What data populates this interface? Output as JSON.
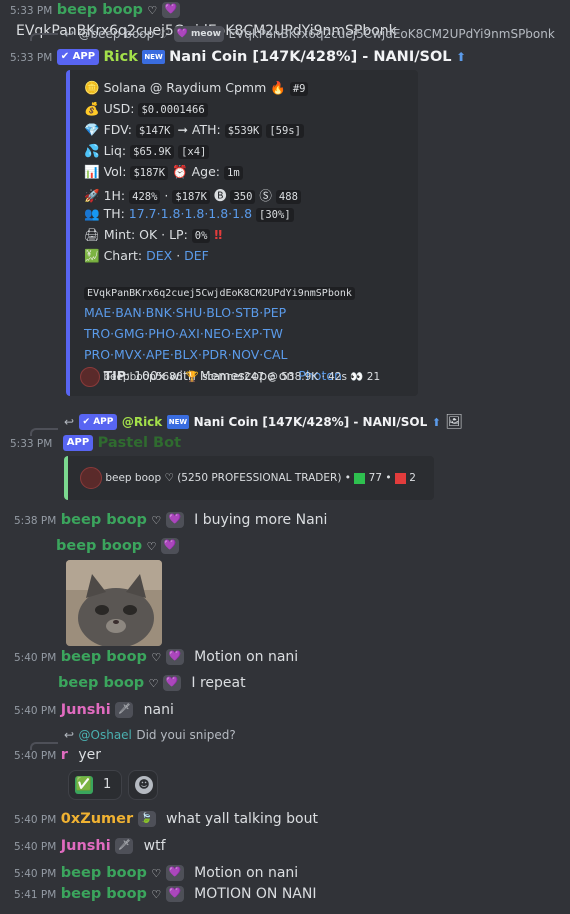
{
  "messages": {
    "m1": {
      "time": "5:33 PM",
      "author": "beep boop",
      "heart": "♡",
      "text": "EVqkPanBKrx6q2cuej5CwjdEoK8CM2UPdYi9nmSPbonk"
    },
    "m2": {
      "reply_author": "@beep boop",
      "reply_heart": "♡",
      "reply_tag": "meow",
      "reply_text": "EVqkPanBKrx6q2cuej5CwjdEoK8CM2UPdYi9nmSPbonk",
      "time": "5:33 PM",
      "app_badge": "APP",
      "author": "Rick",
      "new_badge": "NEW",
      "title": "Nani Coin [147K/428%] - NANI/SOL",
      "arrow": "⬆"
    },
    "embed": {
      "platform": "Solana @ Raydium Cpmm",
      "rank": "#9",
      "usd_label": "USD:",
      "usd": "$0.0001466",
      "fdv_label": "FDV:",
      "fdv": "$147K",
      "ath_arrow": "➞ ATH:",
      "ath": "$539K",
      "ath_age": "[59s]",
      "liq_label": "Liq:",
      "liq": "$65.9K",
      "liq_mult": "[x4]",
      "vol_label": "Vol:",
      "vol": "$187K",
      "age_label": "Age:",
      "age": "1m",
      "h1_label": "1H:",
      "h1_pct": "428%",
      "h1_sep": "·",
      "h1_vol": "$187K",
      "h1_buys": "350",
      "h1_sells": "488",
      "th_label": "TH:",
      "th_values": "17.7·1.8·1.8·1.8·1.8",
      "th_pct": "[30%]",
      "mint_text": "Mint: OK · LP:",
      "lp": "0%",
      "alert": "‼",
      "chart_label": "Chart:",
      "chart_dex": "DEX",
      "chart_dot": "·",
      "chart_def": "DEF",
      "ca": "EVqkPanBKrx6q2cuej5CwjdEoK8CM2UPdYi9nmSPbonk",
      "links_row1": "MAE·BAN·BNK·SHU·BLO·STB·PEP",
      "links_row2": "TRO·GMG·PHO·AXI·NEO·EXP·TW",
      "links_row3": "PRO·MVX·APE·BLX·PDR·NOV·CAL",
      "tip_label": "TIP",
      "tip_text": ": 100x with Memescope on",
      "tip_link": "Photon",
      "footer": "beepboop5686 🏆 scanner247 @ 538.9K · 42s 👀 21"
    },
    "m3": {
      "reply_app": "APP",
      "reply_author": "@Rick",
      "reply_new": "NEW",
      "reply_text": "Nani Coin [147K/428%] - NANI/SOL",
      "reply_arrow": "⬆",
      "time": "5:33 PM",
      "app_badge": "APP",
      "author": "Pastel Bot",
      "embed_text": "beep boop ♡ (5250 PROFESSIONAL TRADER) •",
      "green_count": "77",
      "dot": "•",
      "red_count": "2"
    },
    "m4": {
      "time": "5:38 PM",
      "author": "beep boop",
      "heart": "♡",
      "text": "I buying more Nani"
    },
    "m5": {
      "author": "beep boop",
      "heart": "♡"
    },
    "m6": {
      "time": "5:40 PM",
      "author": "beep boop",
      "heart": "♡",
      "text": "Motion on nani"
    },
    "m7": {
      "author": "beep boop",
      "heart": "♡",
      "text": "I repeat"
    },
    "m8": {
      "time": "5:40 PM",
      "author": "Junshi",
      "text": "nani"
    },
    "m9": {
      "reply_author": "@Oshael",
      "reply_text": "Did youi sniped?",
      "time": "5:40 PM",
      "author": "r",
      "text": "yer",
      "reaction_emoji": "✅",
      "reaction_count": "1"
    },
    "m10": {
      "time": "5:40 PM",
      "author": "0xZumer",
      "text": "what yall talking bout"
    },
    "m11": {
      "time": "5:40 PM",
      "author": "Junshi",
      "text": "wtf"
    },
    "m12": {
      "time": "5:40 PM",
      "author": "beep boop",
      "heart": "♡",
      "text": "Motion on nani"
    },
    "m13": {
      "time": "5:41 PM",
      "author": "beep boop",
      "heart": "♡",
      "text": "MOTION ON NANI"
    }
  },
  "colors": {
    "background": "#313338",
    "beep_boop": "#3ba55d",
    "junshi": "#e06bbf",
    "zumer": "#f0b232",
    "link": "#5b9bea",
    "app_badge": "#5865f2"
  }
}
